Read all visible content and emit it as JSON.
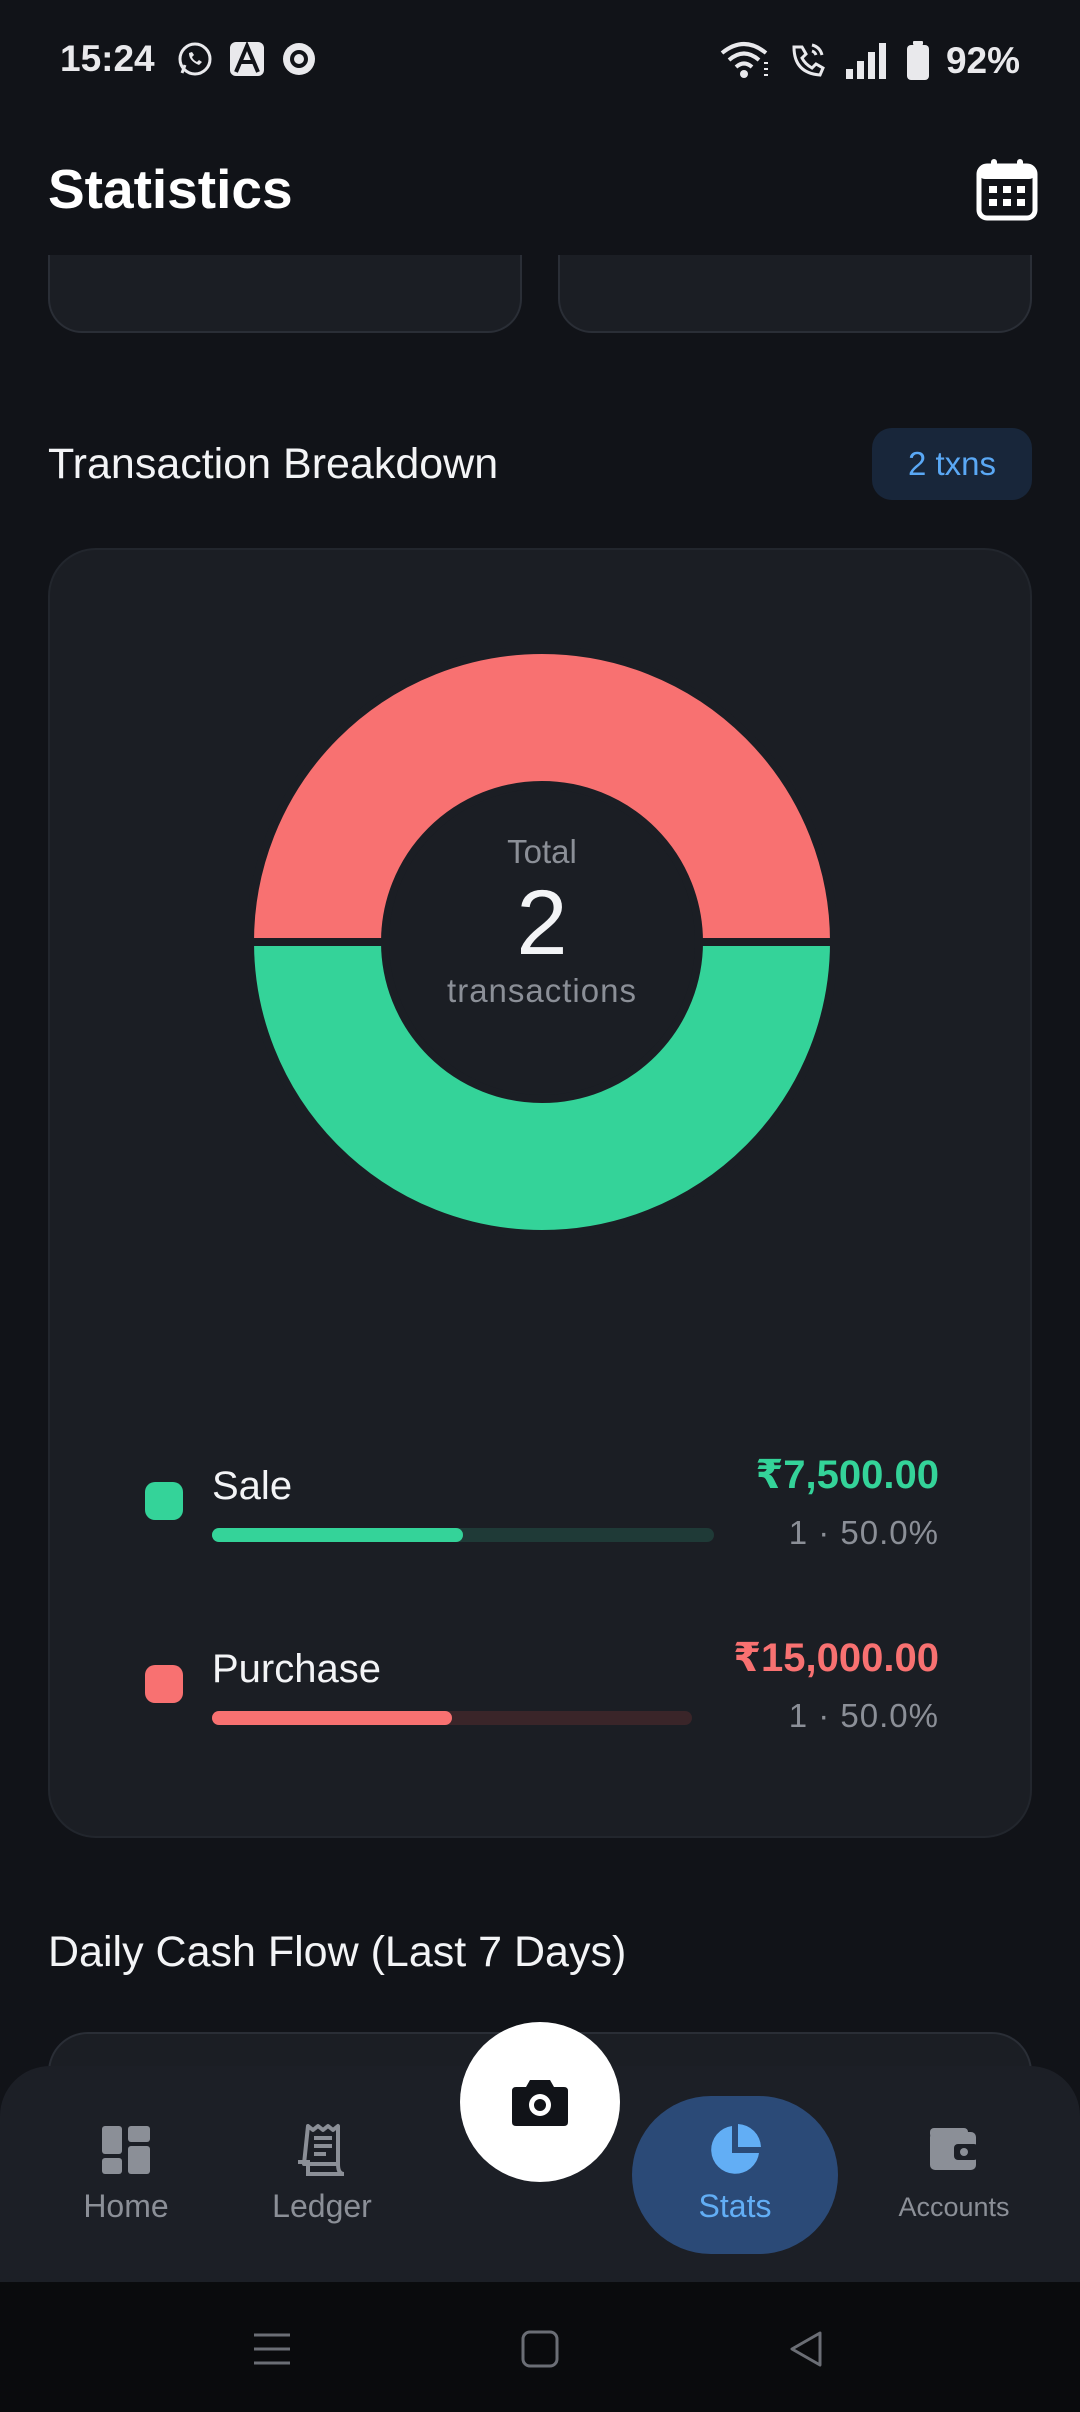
{
  "status_bar": {
    "time": "15:24",
    "battery": "92%",
    "app_icons": [
      "whatsapp-icon",
      "a-app-icon",
      "circle-app-icon"
    ],
    "system_icons": [
      "wifi-icon",
      "wifi-call-icon",
      "signal-icon",
      "battery-icon"
    ]
  },
  "header": {
    "title": "Statistics",
    "calendar_icon": "calendar-icon"
  },
  "breakdown": {
    "title": "Transaction Breakdown",
    "badge": "2 txns",
    "center_label": "Total",
    "center_count": "2",
    "center_sub": "transactions",
    "items": [
      {
        "name": "Sale",
        "amount": "₹7,500.00",
        "meta": "1 · 50.0%",
        "share": 0.5,
        "color": "#34d399",
        "track": "#1f3a37"
      },
      {
        "name": "Purchase",
        "amount": "₹15,000.00",
        "meta": "1 · 50.0%",
        "share": 0.5,
        "color": "#f87171",
        "track": "#3a2529"
      }
    ]
  },
  "chart_data": {
    "type": "pie",
    "categories": [
      "Purchase",
      "Sale"
    ],
    "values": [
      1,
      1
    ],
    "colors": [
      "#f87171",
      "#34d399"
    ],
    "total": 2
  },
  "cash_flow": {
    "title": "Daily Cash Flow (Last 7 Days)"
  },
  "nav": {
    "home": "Home",
    "ledger": "Ledger",
    "stats": "Stats",
    "accounts": "Accounts",
    "active": "Stats",
    "camera_icon": "camera-icon"
  },
  "colors": {
    "background": "#111318",
    "card": "#1b1e24",
    "accent": "#62aef5",
    "sale": "#34d399",
    "purchase": "#f87171"
  }
}
